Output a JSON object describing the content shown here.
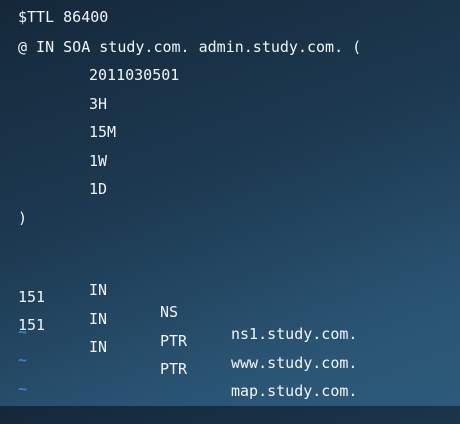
{
  "file": {
    "ttl_line": "$TTL 86400",
    "soa_line": "@ IN SOA study.com. admin.study.com. (",
    "soa_values": [
      "2011030501",
      "3H",
      "15M",
      "1W",
      "1D"
    ],
    "close_paren": ")"
  },
  "records": [
    {
      "name": "",
      "class": "IN",
      "type": "NS",
      "target": "ns1.study.com."
    },
    {
      "name": "151",
      "class": "IN",
      "type": "PTR",
      "target": "www.study.com."
    },
    {
      "name": "151",
      "class": "IN",
      "type": "PTR",
      "target": "map.study.com."
    }
  ],
  "empty_line_marker": "~",
  "colors": {
    "text": "#f2f5f8",
    "tilde": "#3a83d6",
    "background_top": "#15283a",
    "background_bottom": "#2d5a7a"
  }
}
